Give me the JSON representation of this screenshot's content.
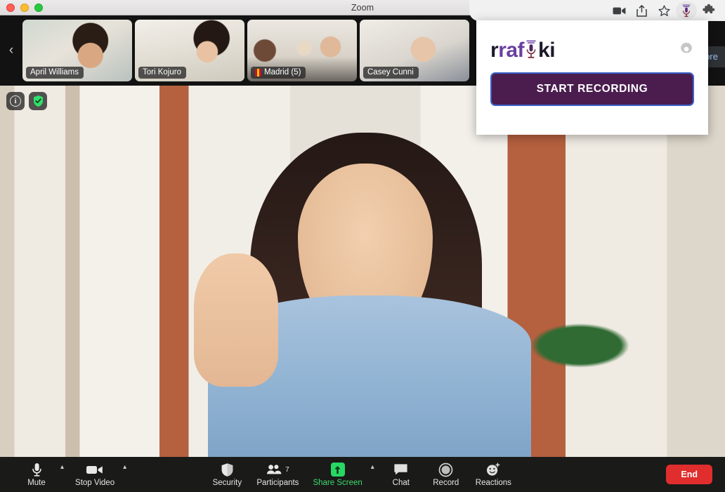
{
  "zoom_window": {
    "title": "Zoom",
    "traffic_lights": [
      "close",
      "minimize",
      "maximize"
    ],
    "filmstrip": {
      "nav_prev_label": "‹",
      "participants": [
        {
          "name": "April Williams",
          "active": false,
          "has_flag": false
        },
        {
          "name": "Tori Kojuro",
          "active": true,
          "has_flag": false
        },
        {
          "name": "Madrid (5)",
          "active": false,
          "has_flag": true
        },
        {
          "name": "Casey Cunni",
          "active": false,
          "has_flag": false
        }
      ],
      "overflow_label": "more"
    },
    "stage": {
      "info_badge": "i",
      "encryption_badge": "shield-check"
    },
    "toolbar": {
      "left": [
        {
          "icon": "microphone-icon",
          "label": "Mute",
          "caret": true
        },
        {
          "icon": "video-camera-icon",
          "label": "Stop Video",
          "caret": true
        }
      ],
      "middle": [
        {
          "icon": "shield-icon",
          "label": "Security",
          "caret": false,
          "badge": ""
        },
        {
          "icon": "participants-icon",
          "label": "Participants",
          "caret": false,
          "badge": "7"
        },
        {
          "icon": "share-screen-icon",
          "label": "Share Screen",
          "caret": true,
          "badge": "",
          "accent": true
        },
        {
          "icon": "chat-icon",
          "label": "Chat",
          "caret": false,
          "badge": ""
        },
        {
          "icon": "record-icon",
          "label": "Record",
          "caret": false,
          "badge": ""
        },
        {
          "icon": "reactions-icon",
          "label": "Reactions",
          "caret": false,
          "badge": ""
        }
      ],
      "end_label": "End"
    }
  },
  "browser": {
    "toolbar_icons": [
      "video-camera-icon",
      "share-icon",
      "star-icon",
      "rafiki-extension-icon",
      "extensions-puzzle-icon"
    ],
    "popup": {
      "brand_part1": "raf",
      "brand_part2": "ki",
      "brand_mic_icon": "microphone-icon",
      "settings_icon": "gear-icon",
      "primary_button": "START RECORDING"
    }
  },
  "colors": {
    "accent_purple": "#6a3fa0",
    "button_purple": "#4b1d4f",
    "button_border_blue": "#3c63c9",
    "active_speaker_green": "#2ec44f",
    "share_screen_green": "#3ddc6e",
    "end_red": "#e02d2d",
    "toolbar_bg": "#1a1a19"
  }
}
